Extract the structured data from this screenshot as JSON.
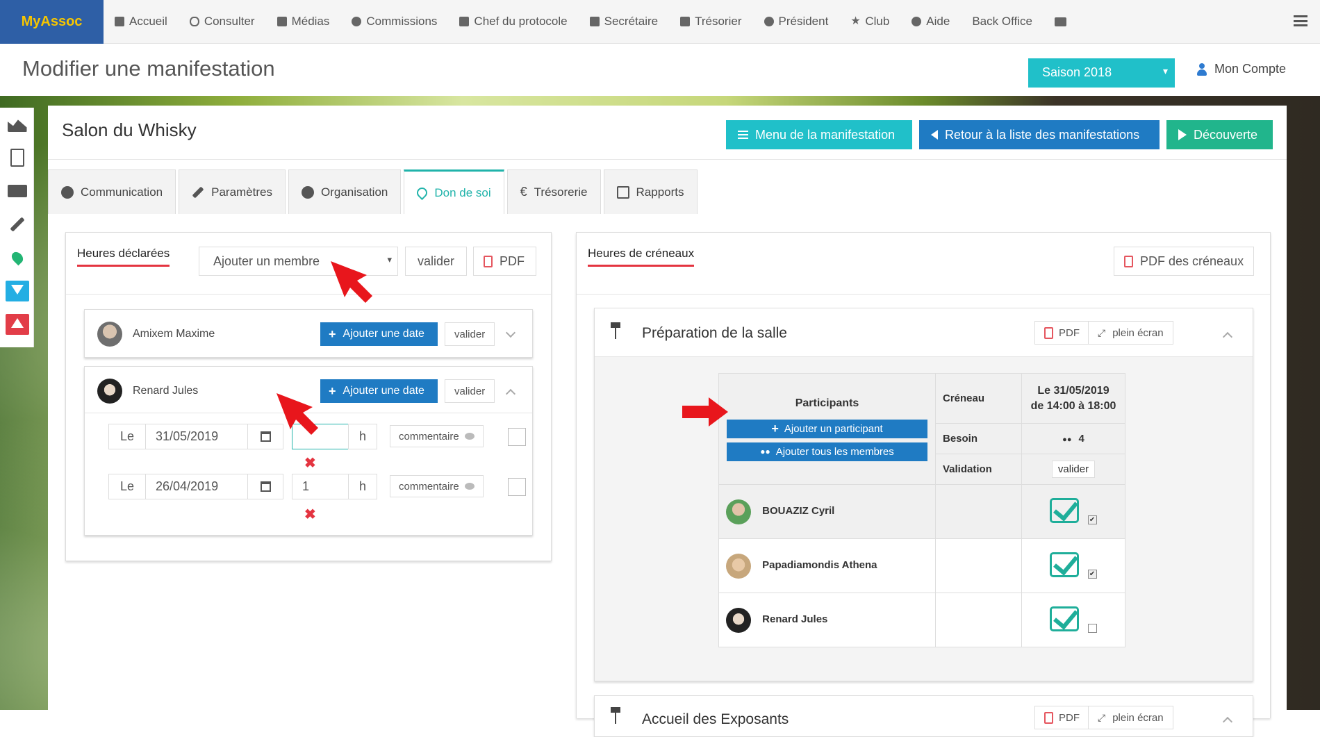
{
  "brand": "MyAssoc",
  "nav": [
    "Accueil",
    "Consulter",
    "Médias",
    "Commissions",
    "Chef du protocole",
    "Secrétaire",
    "Trésorier",
    "Président",
    "Club",
    "Aide",
    "Back Office"
  ],
  "page_title": "Modifier une manifestation",
  "season": "Saison 2018",
  "account": "Mon Compte",
  "event": {
    "title": "Salon du Whisky",
    "buttons": {
      "menu": "Menu de la manifestation",
      "back": "Retour à la liste des manifestations",
      "discover": "Découverte"
    }
  },
  "tabs": [
    "Communication",
    "Paramètres",
    "Organisation",
    "Don de soi",
    "Trésorerie",
    "Rapports"
  ],
  "declared": {
    "title": "Heures déclarées",
    "add_member_placeholder": "Ajouter un membre",
    "validate": "valider",
    "pdf": "PDF",
    "members": [
      {
        "name": "Amixem Maxime",
        "add_date": "Ajouter une date",
        "validate": "valider"
      },
      {
        "name": "Renard Jules",
        "add_date": "Ajouter une date",
        "validate": "valider",
        "entries": [
          {
            "le": "Le",
            "date": "31/05/2019",
            "hours": "",
            "unit": "h",
            "comment": "commentaire"
          },
          {
            "le": "Le",
            "date": "26/04/2019",
            "hours": "1",
            "unit": "h",
            "comment": "commentaire"
          }
        ]
      }
    ]
  },
  "slots": {
    "title": "Heures de créneaux",
    "pdf_slots": "PDF des créneaux",
    "section": {
      "title": "Préparation de la salle",
      "pdf": "PDF",
      "fullscreen": "plein écran",
      "participants_header": "Participants",
      "add_participant": "Ajouter un participant",
      "add_all": "Ajouter tous les membres",
      "creneau_label": "Créneau",
      "creneau_value_line1": "Le 31/05/2019",
      "creneau_value_line2": "de 14:00 à 18:00",
      "besoin_label": "Besoin",
      "besoin_value": "4",
      "validation_label": "Validation",
      "validation_btn": "valider",
      "participants": [
        "BOUAZIZ Cyril",
        "Papadiamondis Athena",
        "Renard Jules"
      ],
      "participant_checks": [
        "✔",
        "✔",
        ""
      ]
    },
    "next_section": {
      "title": "Accueil des Exposants",
      "pdf": "PDF",
      "fullscreen": "plein écran"
    }
  }
}
